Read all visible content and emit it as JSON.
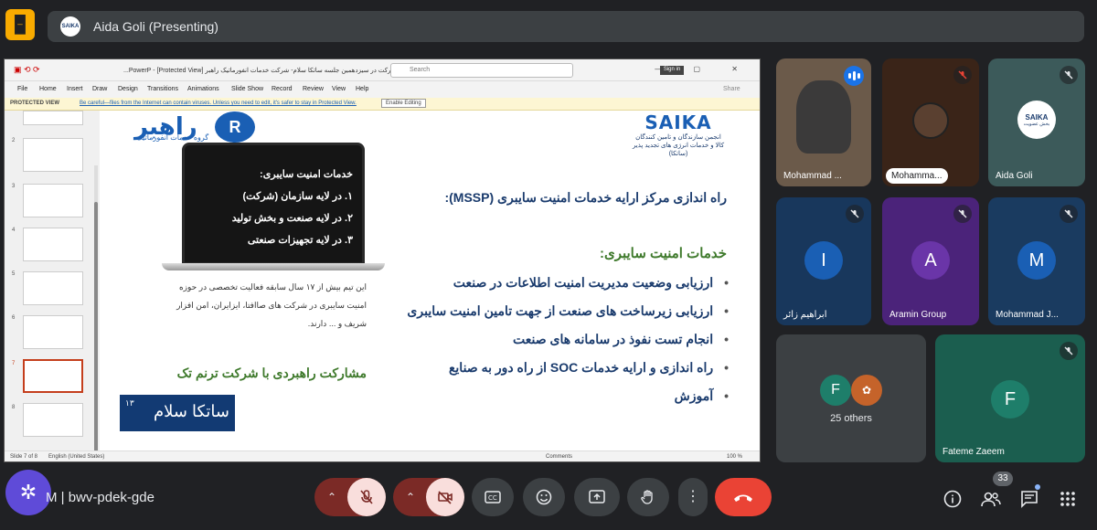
{
  "topbar": {
    "app_logo": "🁢",
    "presenter_avatar_text": "SAIKA",
    "presenter_label": "Aida Goli (Presenting)"
  },
  "ppt": {
    "title_text": "قالب ارائه شرکت در سیزدهمین جلسه ساتکا سلام- شرکت خدمات انفورماتیک راهبر  [Protected View] - PowerP...",
    "search_placeholder": "Search",
    "signin_label": "Sign in",
    "menu": [
      "File",
      "Home",
      "Insert",
      "Draw",
      "Design",
      "Transitions",
      "Animations",
      "Slide Show",
      "Record",
      "Review",
      "View",
      "Help"
    ],
    "share_label": "Share",
    "protected_label": "PROTECTED VIEW",
    "protected_message": "Be careful—files from the Internet can contain viruses. Unless you need to edit, it's safer to stay in Protected View.",
    "enable_editing": "Enable Editing",
    "thumb_numbers": [
      "2",
      "3",
      "4",
      "5",
      "6",
      "7",
      "8"
    ],
    "status_slide": "Slide 7 of 8",
    "status_language": "English (United States)",
    "status_comments": "Comments",
    "status_zoom": "100 %"
  },
  "slide": {
    "rahbar_name": "راهبر",
    "rahbar_sub": "گروه خدمات انفورماتیک",
    "saika_name": "SAIKA",
    "saika_sub1": "انجمن سازندگان و تامین کنندگان",
    "saika_sub2": "کالا و خدمات انرژی های تجدید پذیر (ساتکا)",
    "laptop_title": "خدمات امنیت سایبری:",
    "laptop_items": [
      "۱. در لایه سازمان (شرکت)",
      "۲. در لایه صنعت و بخش تولید",
      "۳. در لایه تجهیزات صنعتی"
    ],
    "description": "این تیم بیش از ۱۷ سال سابقه فعالیت تخصصی در حوزه امنیت سایبری در شرکت های صاافتا، ایزایران، امن افزار شریف و ... دارند.",
    "partnership": "مشارکت راهبردی با شرکت ترنم تک",
    "salam_number": "۱۳",
    "salam_text": "ساتکا سلام",
    "mssp_title": "راه اندازی مرکز ارایه خدمات امنیت سایبری (MSSP):",
    "services_title": "خدمات امنیت سایبری:",
    "services": [
      "ارزیابی وضعیت مدیریت امنیت اطلاعات در صنعت",
      "ارزیابی زیرساخت های صنعت از جهت تامین امنیت سایبری",
      "انجام تست نفوذ در سامانه های صنعت",
      "راه اندازی و ارایه خدمات SOC از راه دور به صنایع",
      "آموزش"
    ]
  },
  "participants": [
    {
      "name": "Mohammad ...",
      "kind": "video-speaking"
    },
    {
      "name": "Mohamma...",
      "kind": "image"
    },
    {
      "name": "Aida Goli",
      "kind": "logo",
      "logo_text": "SAIKA",
      "logo_sub": "بخش عضویت"
    },
    {
      "name": "ابراهیم زائر",
      "initial": "I",
      "color": "#1a3b6d"
    },
    {
      "name": "Aramin Group",
      "initial": "A",
      "color": "#5b2a86"
    },
    {
      "name": "Mohammad J...",
      "initial": "M",
      "color": "#1a4a75"
    },
    {
      "name": "25 others",
      "initial": "F",
      "color": "#1e7e6a"
    },
    {
      "name": "Fateme Zaeem",
      "initial": "F",
      "color": "#1e7e6a"
    }
  ],
  "colors": {
    "tile_blue": "#18375c",
    "tile_purple": "#4b237a",
    "tile_teal": "#1b5e4f",
    "tile_grey": "#3c4043",
    "end_call": "#ea4335"
  },
  "bottom": {
    "meet_code_prefix": "M",
    "meet_code": "bwv-pdek-gde",
    "people_count": "33"
  }
}
